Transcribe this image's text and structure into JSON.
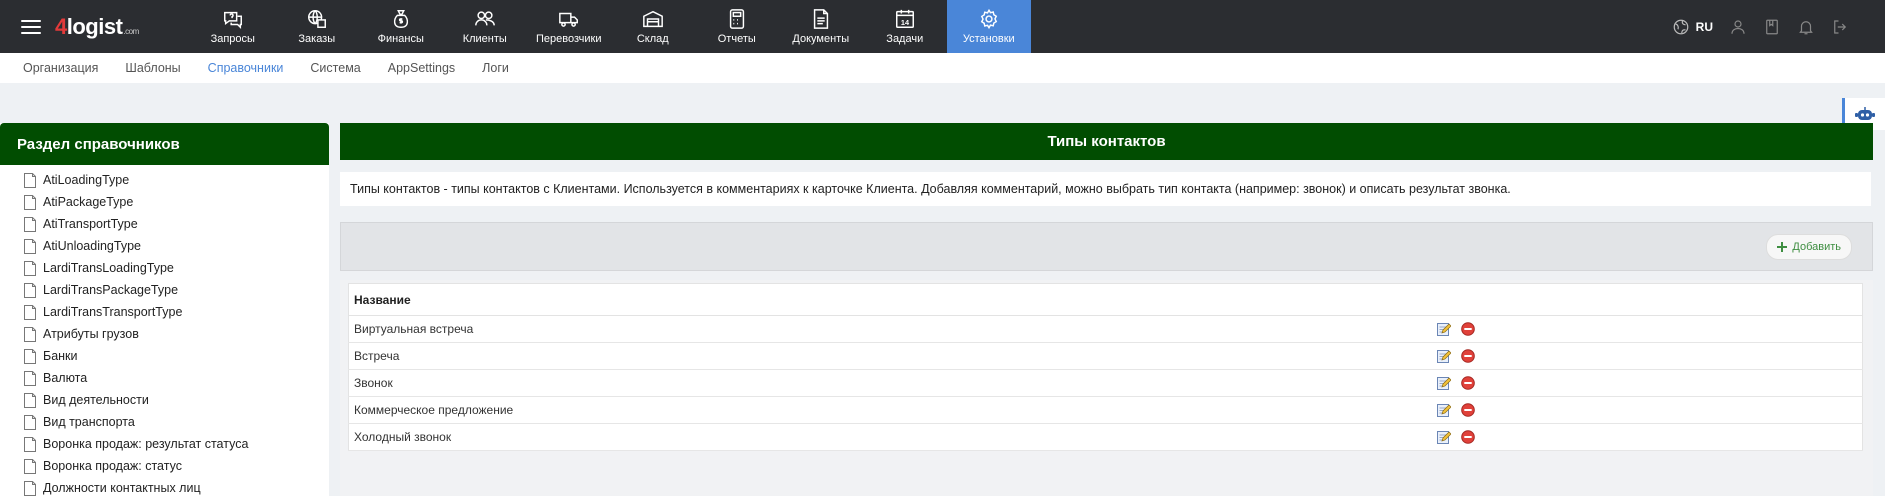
{
  "brand": {
    "logo_num": "4",
    "logo_text": "logist",
    "logo_suffix": ".com"
  },
  "nav": [
    {
      "label": "Запросы",
      "icon": "chat-question-icon"
    },
    {
      "label": "Заказы",
      "icon": "globe-box-icon"
    },
    {
      "label": "Финансы",
      "icon": "money-bag-icon"
    },
    {
      "label": "Клиенты",
      "icon": "users-icon"
    },
    {
      "label": "Перевозчики",
      "icon": "truck-icon"
    },
    {
      "label": "Склад",
      "icon": "warehouse-icon"
    },
    {
      "label": "Отчеты",
      "icon": "calculator-icon"
    },
    {
      "label": "Документы",
      "icon": "document-icon"
    },
    {
      "label": "Задачи",
      "icon": "calendar-icon"
    },
    {
      "label": "Установки",
      "icon": "gear-icon",
      "active": true
    }
  ],
  "lang": "RU",
  "subnav": [
    "Организация",
    "Шаблоны",
    "Справочники",
    "Система",
    "AppSettings",
    "Логи"
  ],
  "subnav_active": "Справочники",
  "sidebar": {
    "title": "Раздел справочников",
    "items": [
      "AtiLoadingType",
      "AtiPackageType",
      "AtiTransportType",
      "AtiUnloadingType",
      "LardiTransLoadingType",
      "LardiTransPackageType",
      "LardiTransTransportType",
      "Атрибуты грузов",
      "Банки",
      "Валюта",
      "Вид деятельности",
      "Вид транспорта",
      "Воронка продаж: результат статуса",
      "Воронка продаж: статус",
      "Должности контактных лиц"
    ]
  },
  "main": {
    "title": "Типы контактов",
    "description": "Типы контактов - типы контактов с Клиентами. Используется в комментариях к карточке Клиента. Добавляя комментарий, можно выбрать тип контакта (например: звонок) и описать результат звонка.",
    "add_label": "Добавить",
    "table": {
      "header": "Название",
      "rows": [
        "Виртуальная встреча",
        "Встреча",
        "Звонок",
        "Коммерческое предложение",
        "Холодный звонок"
      ]
    }
  },
  "colors": {
    "header_green": "#014d01",
    "active_blue": "#4a86d8",
    "topbar": "#2b2d31"
  }
}
